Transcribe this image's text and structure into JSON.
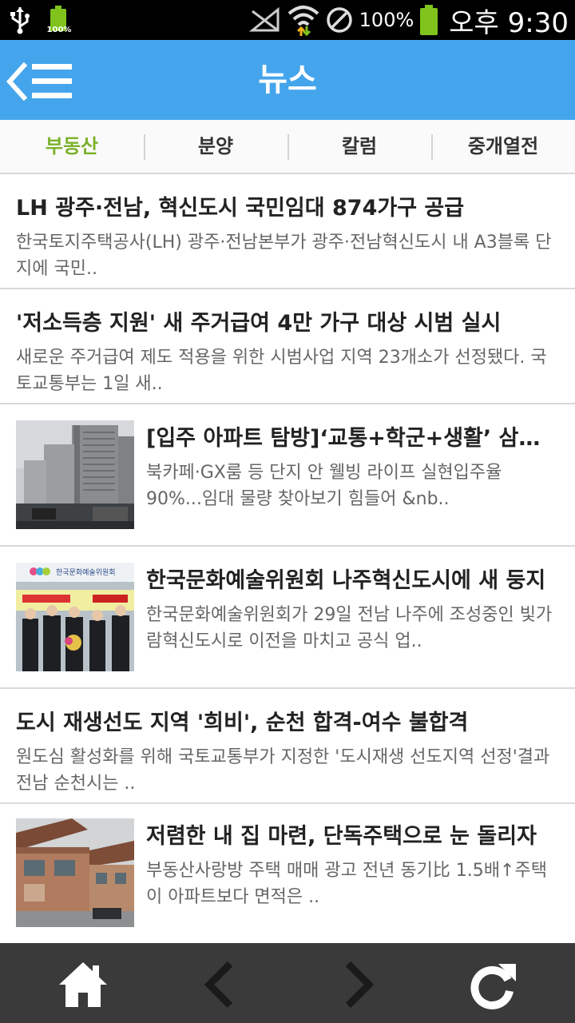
{
  "status_bar": {
    "battery_small_label": "100%",
    "battery_percent": "100%",
    "time": "오후 9:30"
  },
  "header": {
    "title": "뉴스"
  },
  "tabs": [
    {
      "label": "부동산",
      "active": true
    },
    {
      "label": "분양",
      "active": false
    },
    {
      "label": "칼럼",
      "active": false
    },
    {
      "label": "중개열전",
      "active": false
    }
  ],
  "news": [
    {
      "title": "LH 광주·전남, 혁신도시 국민임대 874가구 공급",
      "summary": " 한국토지주택공사(LH) 광주·전남본부가 광주·전남혁신도시 내 A3블록 단지에 국민.."
    },
    {
      "title": "'저소득층 지원' 새 주거급여 4만 가구 대상 시범 실시",
      "summary": "새로운 주거급여 제도 적용을 위한 시범사업 지역 23개소가 선정됐다. 국토교통부는 1일 새.."
    },
    {
      "title": "[입주 아파트 탐방]‘교통+학군+생활’ 삼박자 갖춘...",
      "summary": "북카페·GX룸 등 단지 안 웰빙 라이프 실현입주율 90%...임대 물량 찾아보기 힘들어 &nb..",
      "thumb": "apartment-photo"
    },
    {
      "title": "한국문화예술위원회 나주혁신도시에 새 둥지",
      "summary": "한국문화예술위원회가 29일 전남 나주에 조성중인 빛가람혁신도시로 이전을 마치고 공식 업..",
      "thumb": "ceremony-photo",
      "thumb_sign_text": "한국문화예술위원회"
    },
    {
      "title": "도시 재생선도 지역 '희비', 순천 합격-여수 불합격",
      "summary": "원도심 활성화를 위해 국토교통부가 지정한 '도시재생 선도지역 선정'결과 전남 순천시는 .."
    },
    {
      "title": "저렴한 내 집 마련, 단독주택으로 눈 돌리자",
      "summary": "  부동산사랑방 주택 매매 광고 전년 동기比 1.5배↑주택이 아파트보다 면적은 ..",
      "thumb": "house-photo"
    }
  ],
  "bottom_bar": {
    "home_icon": "home-icon",
    "back_icon": "chevron-left-icon",
    "forward_icon": "chevron-right-icon",
    "refresh_icon": "refresh-icon"
  },
  "colors": {
    "header_bg": "#45a5ec",
    "active_tab": "#7bb12a",
    "bottom_bar": "#3a3a3a"
  }
}
